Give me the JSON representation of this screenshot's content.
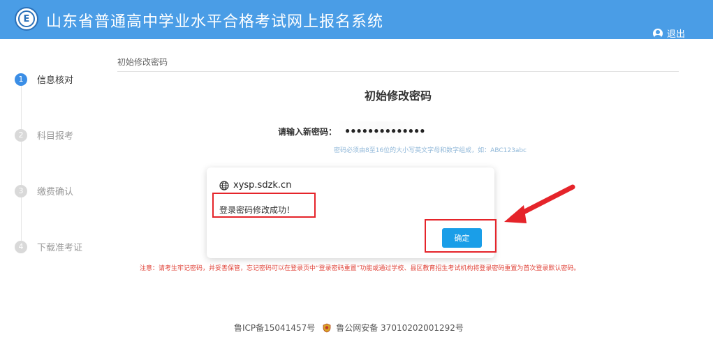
{
  "header": {
    "logo_text": "E",
    "title": "山东省普通高中学业水平合格考试网上报名系统",
    "logout_label": "退出"
  },
  "steps": [
    {
      "num": "1",
      "label": "信息核对",
      "active": true
    },
    {
      "num": "2",
      "label": "科目报考",
      "active": false
    },
    {
      "num": "3",
      "label": "缴费确认",
      "active": false
    },
    {
      "num": "4",
      "label": "下载准考证",
      "active": false
    }
  ],
  "main": {
    "breadcrumb": "初始修改密码",
    "form_title": "初始修改密码",
    "password_label": "请输入新密码：",
    "password_value": "●●●●●●●●●●●●●●",
    "password_hint": "密码必须由8至16位的大小写英文字母和数字组成，如：ABC123abc",
    "notice": "注意：请考生牢记密码，并妥善保管，忘记密码可以在登录页中“登录密码重置”功能或通过学校、县区教育招生考试机构将登录密码重置为首次登录默认密码。"
  },
  "dialog": {
    "origin": "xysp.sdzk.cn",
    "message": "登录密码修改成功！",
    "ok_label": "确定"
  },
  "footer": {
    "icp": "鲁ICP备15041457号",
    "police": "鲁公网安备 37010202001292号"
  },
  "colors": {
    "header_bg": "#4a9de6",
    "active_step": "#3b8ee6",
    "ok_button": "#1a9ee8",
    "highlight_red": "#e5242a",
    "notice_red": "#e0443a"
  }
}
